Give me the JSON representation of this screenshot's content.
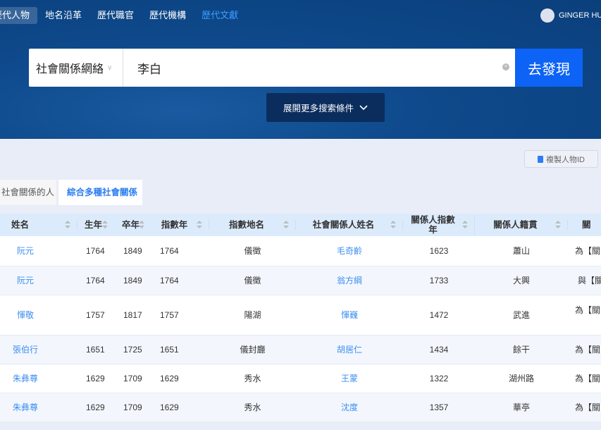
{
  "nav": {
    "items": [
      "歷代人物",
      "地名沿革",
      "歷代職官",
      "歷代機構",
      "歷代文獻"
    ],
    "user": "GINGER HU"
  },
  "search": {
    "type": "社會關係網絡",
    "query": "李白",
    "submit": "去發現",
    "more": "展開更多搜索條件"
  },
  "copy_button": "複製人物ID",
  "tabs": [
    "社會關係的人",
    "綜合多種社會關係"
  ],
  "colors": {
    "accent": "#0d63f5",
    "link": "#3d8ef0",
    "header_bg": "#0b3f7c"
  },
  "table": {
    "headers": [
      "姓名",
      "生年",
      "卒年",
      "指數年",
      "指數地名",
      "社會關係人姓名",
      "關係人指數年",
      "關係人籍貫",
      "關"
    ],
    "rows": [
      [
        "阮元",
        "1764",
        "1849",
        "1764",
        "儀徵",
        "毛奇齡",
        "1623",
        "蕭山",
        "為【關"
      ],
      [
        "阮元",
        "1764",
        "1849",
        "1764",
        "儀徵",
        "翁方綱",
        "1733",
        "大興",
        "與【關"
      ],
      [
        "惲敬",
        "1757",
        "1817",
        "1757",
        "陽湖",
        "惲巍",
        "1472",
        "武進",
        "為【關"
      ],
      [
        "張伯行",
        "1651",
        "1725",
        "1651",
        "儀封廳",
        "胡居仁",
        "1434",
        "餘干",
        "為【關"
      ],
      [
        "朱彝尊",
        "1629",
        "1709",
        "1629",
        "秀水",
        "王蒙",
        "1322",
        "湖州路",
        "為【關"
      ],
      [
        "朱彝尊",
        "1629",
        "1709",
        "1629",
        "秀水",
        "沈度",
        "1357",
        "華亭",
        "為【關"
      ]
    ]
  }
}
